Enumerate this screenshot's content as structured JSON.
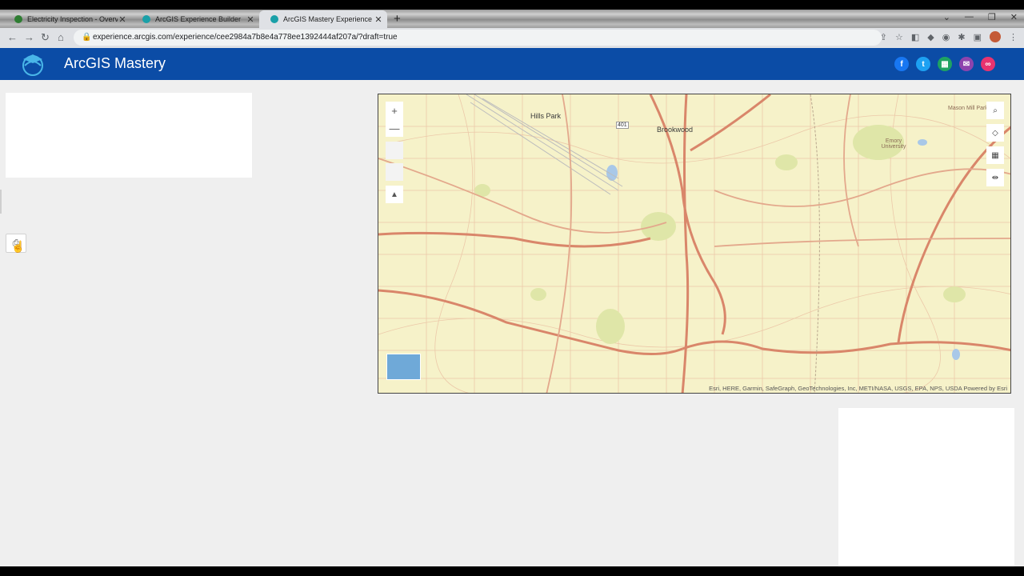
{
  "browser": {
    "tabs": [
      {
        "title": "Electricity Inspection - Overview",
        "favicon_color": "#2e7d32"
      },
      {
        "title": "ArcGIS Experience Builder",
        "favicon_color": "#1aa0a8"
      },
      {
        "title": "ArcGIS Mastery Experience Builder",
        "favicon_color": "#1aa0a8"
      }
    ],
    "close_glyph": "✕",
    "new_tab_glyph": "+",
    "window_controls": [
      "⌄",
      "—",
      "❐",
      "✕"
    ],
    "nav": {
      "back": "←",
      "forward": "→",
      "reload": "↻",
      "home": "⌂"
    },
    "url": "experience.arcgis.com/experience/cee2984a7b8e4a778ee1392444af207a/?draft=true"
  },
  "app": {
    "title": "ArcGIS Mastery",
    "share_icons": [
      {
        "name": "facebook-icon",
        "glyph": "f",
        "color": "#1877f2"
      },
      {
        "name": "twitter-icon",
        "glyph": "t",
        "color": "#1da1f2"
      },
      {
        "name": "sheets-icon",
        "glyph": "▦",
        "color": "#1ea362"
      },
      {
        "name": "email-icon",
        "glyph": "✉",
        "color": "#8e44ad"
      },
      {
        "name": "link-icon",
        "glyph": "∞",
        "color": "#e8336f"
      }
    ]
  },
  "map": {
    "labels": [
      {
        "text": "Hills Park",
        "cls": ""
      },
      {
        "text": "Brookwood",
        "cls": ""
      },
      {
        "text": "Emory University",
        "cls": "small"
      },
      {
        "text": "Mason Mill Park",
        "cls": "small"
      },
      {
        "text": "401",
        "cls": "small"
      }
    ],
    "zoom_in": "+",
    "zoom_out": "—",
    "compass": "▲",
    "attribution": "Esri, HERE, Garmin, SafeGraph, GeoTechnologies, Inc, METI/NASA, USGS, EPA, NPS, USDA   Powered by Esri"
  },
  "colors": {
    "header": "#0b4ca6",
    "road_major": "#d9866a",
    "road_minor": "#e6b79a",
    "land": "#f6f2c9"
  }
}
